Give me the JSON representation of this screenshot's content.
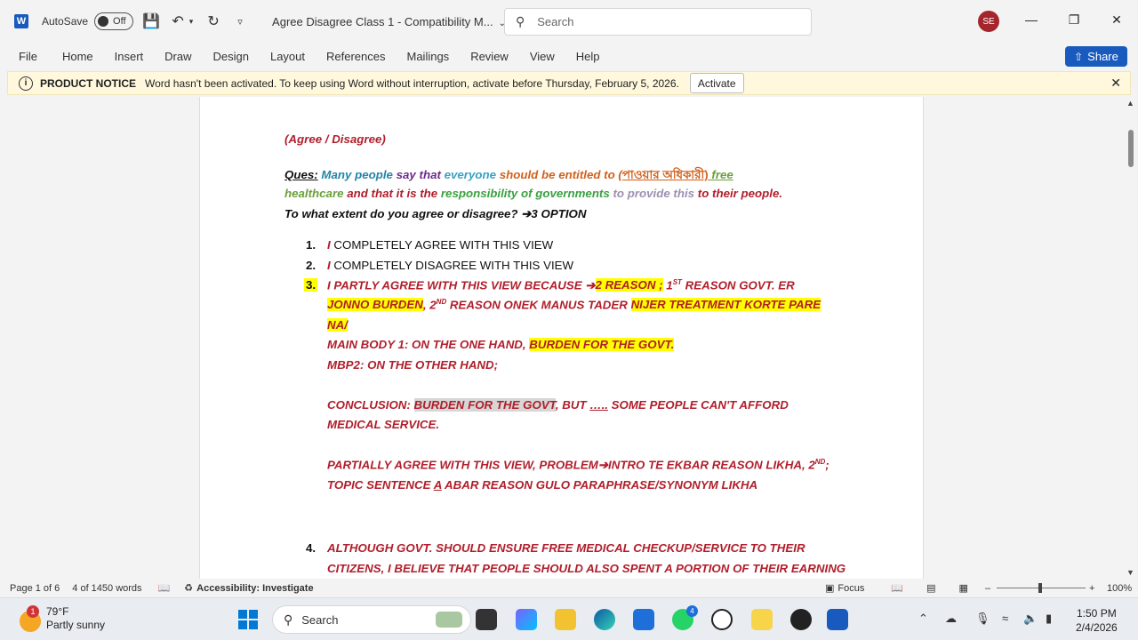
{
  "titlebar": {
    "autosave_label": "AutoSave",
    "autosave_state": "Off",
    "doc_title": "Agree Disagree Class 1  -  Compatibility M...",
    "search_placeholder": "Search",
    "avatar_initials": "SE"
  },
  "menu": {
    "items": [
      "File",
      "Home",
      "Insert",
      "Draw",
      "Design",
      "Layout",
      "References",
      "Mailings",
      "Review",
      "View",
      "Help"
    ],
    "share_label": "Share"
  },
  "notice": {
    "title": "PRODUCT NOTICE",
    "message": "Word hasn't been activated. To keep using Word without interruption, activate before Thursday, February 5, 2026.",
    "button": "Activate"
  },
  "document": {
    "heading": "(Agree / Disagree)",
    "q_label": "Ques:",
    "q_parts": [
      "Many people",
      "say that",
      "everyone",
      "should be entitled to (",
      "পাওয়ার অধিকারী)",
      " free",
      "healthcare",
      " and that it is the ",
      "responsibility of governments",
      " to provide this",
      " to their people."
    ],
    "q_line3": "To what extent do you agree or disagree?",
    "q_line3_suffix": "3 OPTION",
    "opt1_i": "I",
    "opt1": "COMPLETELY AGREE WITH THIS VIEW",
    "opt2_i": "I",
    "opt2": "COMPLETELY DISAGREE WITH THIS VIEW",
    "opt3_a": "I PARTLY AGREE WITH THIS VIEW BECAUSE ",
    "opt3_b": "2 REASON ;",
    "opt3_c": " 1",
    "opt3_sup1": "ST",
    "opt3_d": " REASON GOVT. ER",
    "opt3_e": "JONNO BURDEN",
    "opt3_f": ", 2",
    "opt3_sup2": "ND",
    "opt3_g": " REASON ONEK MANUS TADER ",
    "opt3_h": "NIJER TREATMENT KORTE PARE",
    "opt3_i": "NA/",
    "main_body_1a": "MAIN BODY 1: ON THE ONE HAND, ",
    "main_body_1b": "BURDEN FOR THE GOVT.",
    "mbp2": "MBP2: ON THE OTHER HAND;",
    "concl_a": "CONCLUSION: ",
    "concl_b": "BURDEN FOR THE GOVT",
    "concl_c": ", BUT ",
    "concl_d": "…..",
    "concl_e": " SOME PEOPLE CAN'T AFFORD",
    "concl_line2": "MEDICAL SERVICE.",
    "partial_a": "PARTIALLY AGREE WITH THIS VIEW, PROBLEM",
    "partial_b": "INTRO TE EKBAR REASON LIKHA, 2",
    "partial_sup": "ND",
    "partial_c": ";",
    "topic_a": "TOPIC SENTENCE ",
    "topic_b": "A",
    "topic_c": " ABAR REASON GULO PARAPHRASE/SYNONYM LIKHA",
    "item4_line1": "ALTHOUGH GOVT. SHOULD ENSURE FREE MEDICAL CHECKUP/SERVICE TO THEIR",
    "item4_line2": "CITIZENS, I BELIEVE THAT PEOPLE SHOULD ALSO SPENT A PORTION OF THEIR EARNING",
    "numbers": [
      "1.",
      "2.",
      "3.",
      "4."
    ]
  },
  "status": {
    "page": "Page 1 of 6",
    "words": "4 of 1450 words",
    "accessibility": "Accessibility: Investigate",
    "focus": "Focus",
    "zoom": "100%"
  },
  "taskbar": {
    "weather_temp": "79°F",
    "weather_desc": "Partly sunny",
    "weather_badge": "1",
    "search": "Search",
    "time": "1:50 PM",
    "date": "2/4/2026",
    "whatsapp_badge": "4"
  },
  "colors": {
    "accent": "#185abd",
    "maroon": "#b01e2b",
    "highlight": "#ffff00"
  }
}
